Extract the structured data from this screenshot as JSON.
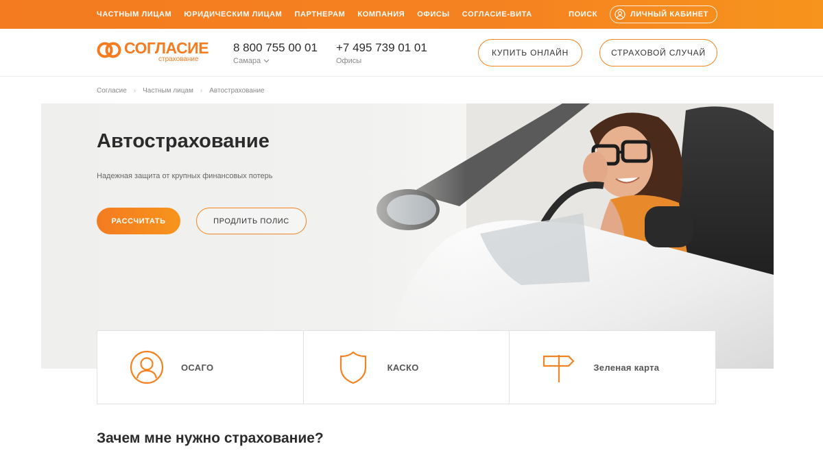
{
  "colors": {
    "accent": "#f58220",
    "text": "#2b2b2b"
  },
  "topnav": {
    "items": [
      "ЧАСТНЫМ ЛИЦАМ",
      "ЮРИДИЧЕСКИМ ЛИЦАМ",
      "ПАРТНЕРАМ",
      "КОМПАНИЯ",
      "ОФИСЫ",
      "СОГЛАСИЕ-ВИТА"
    ],
    "search": "ПОИСК",
    "cabinet": "ЛИЧНЫЙ КАБИНЕТ"
  },
  "header": {
    "logo_name": "СОГЛАСИЕ",
    "logo_sub": "страхование",
    "phone1": {
      "number": "8 800 755 00 01",
      "sub": "Самара"
    },
    "phone2": {
      "number": "+7 495 739 01 01",
      "sub": "Офисы"
    },
    "buy_online": "КУПИТЬ ОНЛАЙН",
    "insurance_case": "СТРАХОВОЙ СЛУЧАЙ"
  },
  "breadcrumb": [
    "Согласие",
    "Частным лицам",
    "Автострахование"
  ],
  "hero": {
    "title": "Автострахование",
    "subtitle": "Надежная защита от крупных финансовых потерь",
    "calc_button": "РАССЧИТАТЬ",
    "renew_button": "ПРОДЛИТЬ ПОЛИС"
  },
  "products": [
    {
      "label": "ОСАГО",
      "icon": "person-circle-icon"
    },
    {
      "label": "КАСКО",
      "icon": "shield-icon"
    },
    {
      "label": "Зеленая карта",
      "icon": "signpost-icon"
    }
  ],
  "section": {
    "title": "Зачем мне нужно страхование?"
  }
}
